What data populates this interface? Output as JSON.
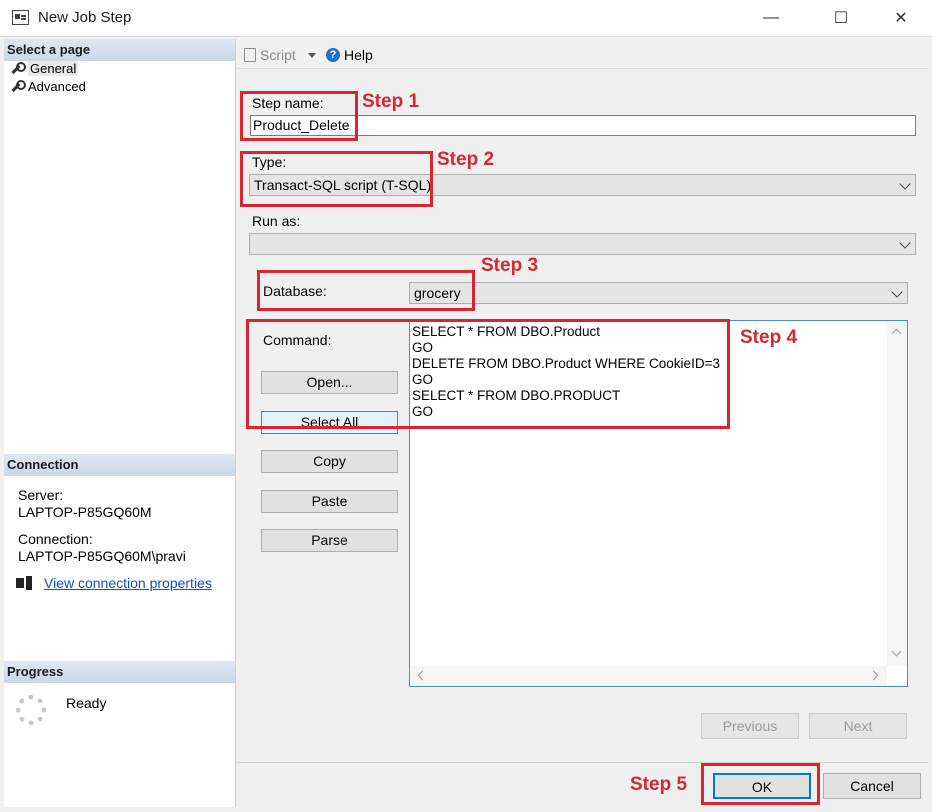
{
  "window": {
    "title": "New Job Step",
    "minimize": "—",
    "maximize": "☐",
    "close": "✕"
  },
  "sidebar": {
    "select_page_header": "Select a page",
    "items": [
      {
        "label": "General"
      },
      {
        "label": "Advanced"
      }
    ],
    "connection_header": "Connection",
    "server_label": "Server:",
    "server_value": "LAPTOP-P85GQ60M",
    "connection_label": "Connection:",
    "connection_value": "LAPTOP-P85GQ60M\\pravi",
    "view_connection_link": "View connection properties",
    "progress_header": "Progress",
    "progress_status": "Ready"
  },
  "toolbar": {
    "script_label": "Script",
    "help_label": "Help"
  },
  "form": {
    "step_name_label": "Step name:",
    "step_name_value": "Product_Delete",
    "type_label": "Type:",
    "type_value": "Transact-SQL script (T-SQL)",
    "run_as_label": "Run as:",
    "run_as_value": "",
    "database_label": "Database:",
    "database_value": "grocery",
    "command_label": "Command:",
    "command_lines": [
      "SELECT * FROM DBO.Product",
      "GO",
      "DELETE FROM DBO.Product WHERE CookieID=3",
      "GO",
      "SELECT * FROM DBO.PRODUCT",
      "GO"
    ]
  },
  "buttons": {
    "open": "Open...",
    "select_all": "Select All",
    "copy": "Copy",
    "paste": "Paste",
    "parse": "Parse",
    "previous": "Previous",
    "next": "Next",
    "ok": "OK",
    "cancel": "Cancel"
  },
  "annotations": {
    "step1": "Step 1",
    "step2": "Step 2",
    "step3": "Step 3",
    "step4": "Step 4",
    "step5": "Step 5"
  },
  "colors": {
    "annotation_red": "#d9262f",
    "link_blue": "#0b4fcb",
    "accent_blue": "#1f6fd1"
  }
}
